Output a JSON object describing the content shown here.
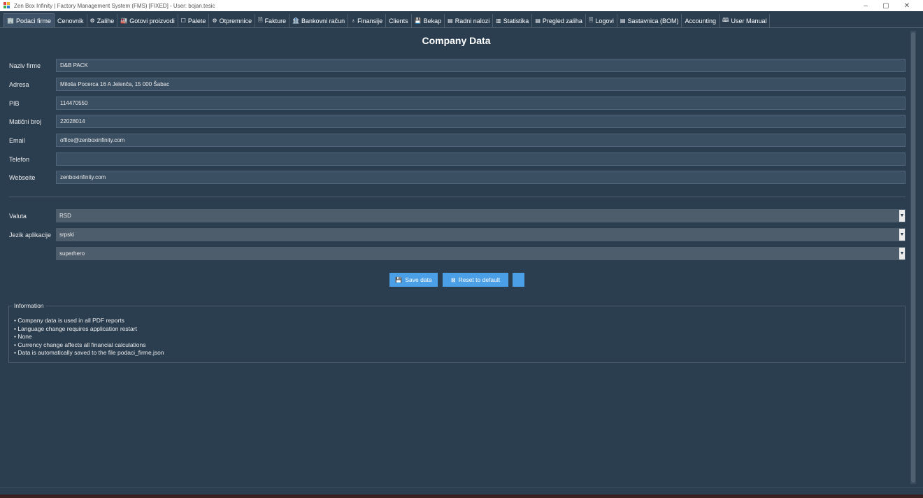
{
  "window": {
    "title": "Zen Box Infinity | Factory Management System (FMS) [FIXED] - User: bojan.tesic",
    "controls": {
      "minimize": "–",
      "maximize": "▢",
      "close": "✕"
    }
  },
  "tabs": [
    {
      "icon": "🏢",
      "label": "Podaci firme",
      "active": true
    },
    {
      "icon": "",
      "label": "Cenovnik"
    },
    {
      "icon": "⚙",
      "label": "Zalihe"
    },
    {
      "icon": "🏭",
      "label": "Gotovi proizvodi"
    },
    {
      "icon": "☐",
      "label": "Palete"
    },
    {
      "icon": "⚙",
      "label": "Otpremnice"
    },
    {
      "icon": "🗎",
      "label": "Fakture"
    },
    {
      "icon": "🏦",
      "label": "Bankovni račun"
    },
    {
      "icon": "♁",
      "label": "Finansije"
    },
    {
      "icon": "",
      "label": "Clients"
    },
    {
      "icon": "💾",
      "label": "Bekap"
    },
    {
      "icon": "▤",
      "label": "Radni nalozi"
    },
    {
      "icon": "▥",
      "label": "Statistika"
    },
    {
      "icon": "▤",
      "label": "Pregled zaliha"
    },
    {
      "icon": "🗎",
      "label": "Logovi"
    },
    {
      "icon": "▤",
      "label": "Sastavnica (BOM)"
    },
    {
      "icon": "",
      "label": "Accounting"
    },
    {
      "icon": "🕮",
      "label": "User Manual"
    }
  ],
  "page": {
    "title": "Company Data"
  },
  "company_fields": [
    {
      "label": "Naziv firme",
      "value": "D&B PACK"
    },
    {
      "label": "Adresa",
      "value": "Miloša Pocerca 16 A Jelenča, 15 000 Šabac"
    },
    {
      "label": "PIB",
      "value": "114470550"
    },
    {
      "label": "Matični broj",
      "value": "22028014"
    },
    {
      "label": "Email",
      "value": "office@zenboxinfinity.com"
    },
    {
      "label": "Telefon",
      "value": ""
    },
    {
      "label": "Webseite",
      "value": "zenboxinfinity.com"
    }
  ],
  "settings": {
    "currency": {
      "label": "Valuta",
      "value": "RSD"
    },
    "language": {
      "label": "Jezik aplikacije",
      "value": "srpski"
    },
    "theme": {
      "label": "",
      "value": "superhero"
    }
  },
  "buttons": {
    "save": {
      "icon": "💾",
      "label": "Save data"
    },
    "reset": {
      "icon": "⊠",
      "label": "Reset to default"
    },
    "extra": {
      "label": ""
    }
  },
  "info": {
    "legend": "Information",
    "lines": [
      "• Company data is used in all PDF reports",
      "• Language change requires application restart",
      "• None",
      "• Currency change affects all financial calculations",
      "• Data is automatically saved to the file podaci_firme.json"
    ]
  },
  "colors": {
    "background": "#2b3e50",
    "accent": "#4b9fe6",
    "field": "#3b4f63",
    "select": "#4e5d6c"
  }
}
